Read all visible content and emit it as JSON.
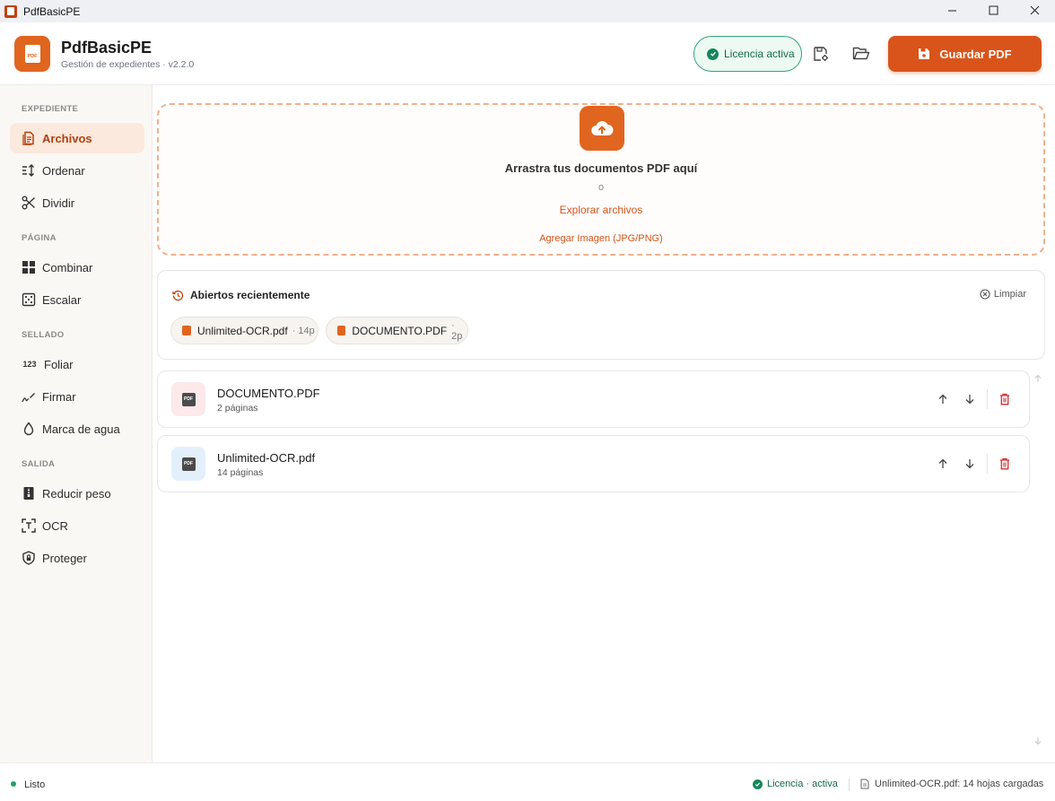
{
  "window": {
    "title": "PdfBasicPE"
  },
  "header": {
    "app_name": "PdfBasicPE",
    "subtitle": "Gestión de expedientes · v2.2.0",
    "license_label": "Licencia activa",
    "save_label": "Guardar PDF",
    "logo_text": "PDF"
  },
  "sidebar": {
    "sections": {
      "expediente": "EXPEDIENTE",
      "pagina": "PÁGINA",
      "sellado": "SELLADO",
      "salida": "SALIDA"
    },
    "items": [
      {
        "label": "Archivos",
        "icon": "file-text-icon",
        "active": true
      },
      {
        "label": "Ordenar",
        "icon": "sort-icon"
      },
      {
        "label": "Dividir",
        "icon": "scissors-icon"
      },
      {
        "label": "Combinar",
        "icon": "grid-icon"
      },
      {
        "label": "Escalar",
        "icon": "scale-icon"
      },
      {
        "label": "Foliar",
        "icon": "numbers-icon",
        "icon_text": "123"
      },
      {
        "label": "Firmar",
        "icon": "signature-icon"
      },
      {
        "label": "Marca de agua",
        "icon": "droplet-icon"
      },
      {
        "label": "Reducir peso",
        "icon": "compress-icon"
      },
      {
        "label": "OCR",
        "icon": "ocr-icon"
      },
      {
        "label": "Proteger",
        "icon": "shield-lock-icon"
      }
    ]
  },
  "dropzone": {
    "title": "Arrastra tus documentos PDF aquí",
    "or_text": "o",
    "browse_label": "Explorar archivos",
    "image_label": "Agregar Imagen (JPG/PNG)"
  },
  "recents": {
    "title": "Abiertos recientemente",
    "clear_label": "Limpiar",
    "items": [
      {
        "name": "Unlimited-OCR.pdf",
        "meta": "· 14p"
      },
      {
        "name": "DOCUMENTO.PDF",
        "meta": "· 2p"
      }
    ]
  },
  "files": [
    {
      "name": "DOCUMENTO.PDF",
      "pages": "2 páginas",
      "thumb_color": "#fde8ea"
    },
    {
      "name": "Unlimited-OCR.pdf",
      "pages": "14 páginas",
      "thumb_color": "#e3f0fc"
    }
  ],
  "statusbar": {
    "status": "Listo",
    "license": "Licencia · activa",
    "file_info": "Unlimited-OCR.pdf: 14 hojas cargadas"
  },
  "colors": {
    "accent": "#e0651f",
    "primary_button": "#d9541a",
    "success": "#16875a",
    "danger": "#d32f2f"
  }
}
